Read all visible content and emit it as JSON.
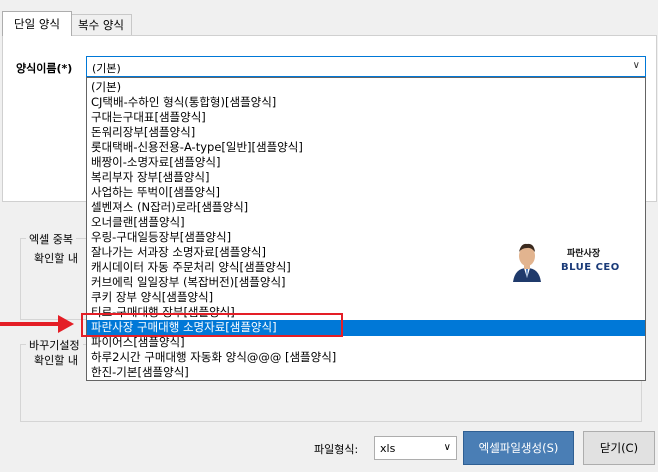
{
  "tabs": [
    {
      "label": "단일 양식"
    },
    {
      "label": "복수 양식"
    }
  ],
  "form": {
    "name_label": "양식이름(*)",
    "name_value": "(기본)"
  },
  "dropdown_items": [
    "(기본)",
    "CJ택배-수하인 형식(통합형)[샘플양식]",
    "구대는구대표[샘플양식]",
    "돈워리장부[샘플양식]",
    "롯대택배-신용전용-A-type[일반][샘플양식]",
    "배짱이-소명자료[샘플양식]",
    "복리부자 장부[샘플양식]",
    "사업하는 뚜벅이[샘플양식]",
    "셀벤져스 (N잡러)로라[샘플양식]",
    "오너클랜[샘플양식]",
    "우링-구대일등장부[샘플양식]",
    "잘나가는 서과장 소명자료[샘플양식]",
    "캐시데이터 자동 주문처리 양식[샘플양식]",
    "커브에릭 일일장부 (복잡버전)[샘플양식]",
    "쿠키 장부 양식[샘플양식]",
    "티르-구매대행 장부[샘플양식]",
    "파란사장 구매대행 소명자료[샘플양식]",
    "파이어스[샘플양식]",
    "하루2시간 구매대행 자동화 양식@@@ [샘플양식]",
    "한진-기본[샘플양식]"
  ],
  "selected_index": 16,
  "excel_group": {
    "title": "엑셀 중복",
    "confirm_label": "확인할 내"
  },
  "barcode_group": {
    "title": "바꾸기설정",
    "confirm_label": "확인할 내"
  },
  "ceo_badge": {
    "name": "파란사장",
    "subtitle": "BLUE CEO"
  },
  "footer": {
    "file_type_label": "파일형식:",
    "file_type_value": "xls",
    "generate_button": "엑셀파일생성(S)",
    "close_button": "닫기(C)"
  },
  "colors": {
    "accent": "#0078d7",
    "highlight": "#e41e26",
    "primary_button": "#4a7eb5"
  }
}
